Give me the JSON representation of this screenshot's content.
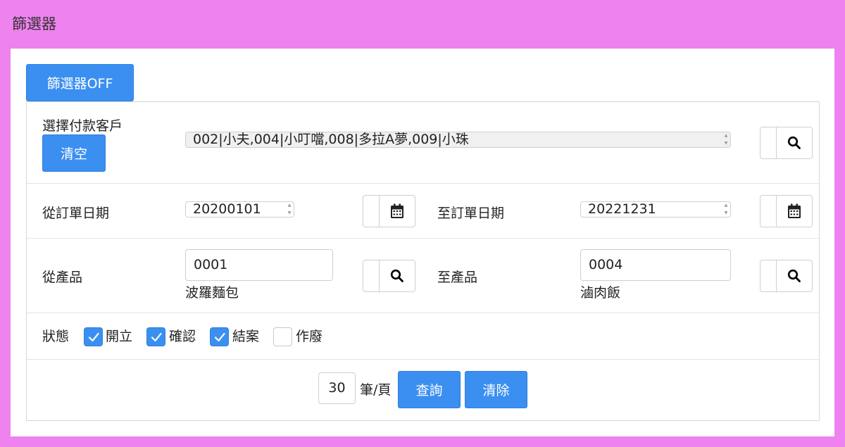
{
  "page": {
    "title": "篩選器"
  },
  "filter_toggle": {
    "label": "篩選器OFF"
  },
  "customer": {
    "label": "選擇付款客戶",
    "clear_label": "清空",
    "value": "002|小夫,004|小叮噹,008|多拉A夢,009|小珠",
    "search_icon": "search-icon"
  },
  "order_date": {
    "from_label": "從訂單日期",
    "from_value": "20200101",
    "to_label": "至訂單日期",
    "to_value": "20221231",
    "calendar_icon": "calendar-icon"
  },
  "product": {
    "from_label": "從產品",
    "from_value": "0001",
    "from_name": "波羅麵包",
    "to_label": "至產品",
    "to_value": "0004",
    "to_name": "滷肉飯",
    "search_icon": "search-icon"
  },
  "status": {
    "label": "狀態",
    "options": [
      {
        "label": "開立",
        "checked": true
      },
      {
        "label": "確認",
        "checked": true
      },
      {
        "label": "結案",
        "checked": true
      },
      {
        "label": "作廢",
        "checked": false
      }
    ]
  },
  "footer": {
    "page_size": "30",
    "per_page_label": "筆/頁",
    "query_label": "查詢",
    "clear_label": "清除"
  },
  "colors": {
    "background": "#ee82ee",
    "primary": "#3b8ff0"
  }
}
